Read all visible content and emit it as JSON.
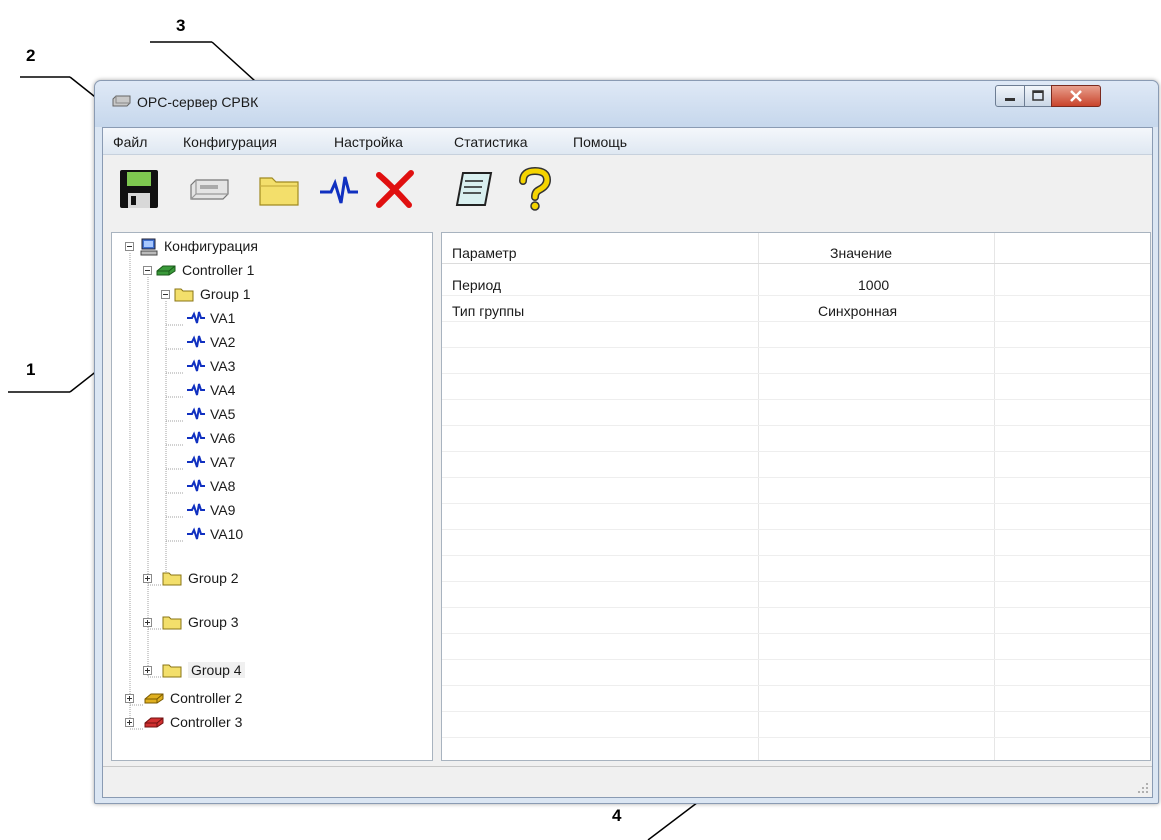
{
  "callouts": {
    "c1": "1",
    "c2": "2",
    "c3": "3",
    "c4": "4"
  },
  "window": {
    "title": "OPC-сервер СРВК",
    "controls": {
      "minimize_icon": "minimize-icon",
      "maximize_icon": "maximize-icon",
      "close_icon": "close-icon"
    }
  },
  "menu": [
    "Файл",
    "Конфигурация",
    "Настройка",
    "Статистика",
    "Помощь"
  ],
  "toolbar": {
    "icons": [
      "save-icon",
      "device-icon",
      "folder-icon",
      "signal-icon",
      "delete-icon",
      "notepad-icon",
      "help-icon"
    ]
  },
  "tree": {
    "root": "Конфигурация",
    "controller1": "Controller 1",
    "group1": "Group 1",
    "vars": [
      "VA1",
      "VA2",
      "VA3",
      "VA4",
      "VA5",
      "VA6",
      "VA7",
      "VA8",
      "VA9",
      "VA10"
    ],
    "group2": "Group 2",
    "group3": "Group 3",
    "group4": "Group 4",
    "controller2": "Controller 2",
    "controller3": "Controller 3"
  },
  "grid": {
    "headers": [
      "Параметр",
      "Значение"
    ],
    "rows": [
      {
        "param": "Период",
        "value": "1000"
      },
      {
        "param": "Тип группы",
        "value": "Синхронная"
      }
    ]
  },
  "colors": {
    "controller1": "#3a9a3a",
    "controller2": "#e0b020",
    "controller3": "#d03030",
    "signal": "#1030c0",
    "delete": "#e01010",
    "folder": "#f3df6b"
  }
}
